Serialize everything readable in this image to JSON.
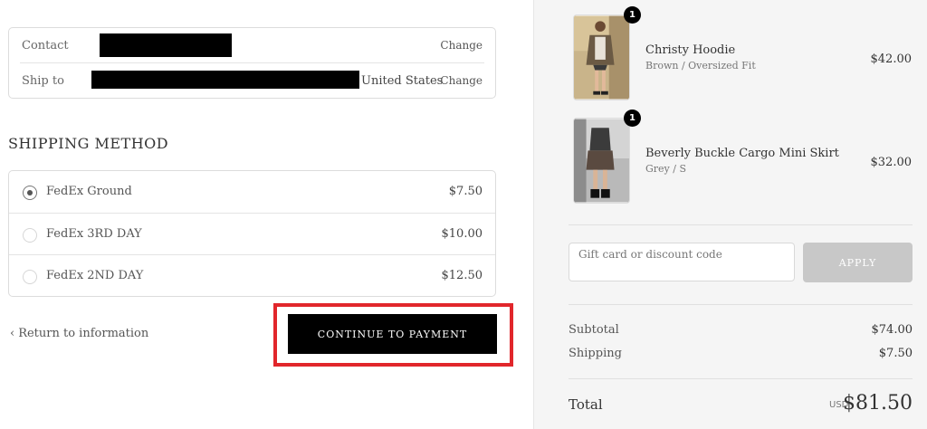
{
  "contact": {
    "label": "Contact",
    "change": "Change"
  },
  "ship_to": {
    "label": "Ship to",
    "country": "United States",
    "change": "Change"
  },
  "shipping": {
    "title": "SHIPPING METHOD",
    "options": [
      {
        "name": "FedEx Ground",
        "price": "$7.50",
        "selected": true
      },
      {
        "name": "FedEx 3RD DAY",
        "price": "$10.00",
        "selected": false
      },
      {
        "name": "FedEx 2ND DAY",
        "price": "$12.50",
        "selected": false
      }
    ]
  },
  "nav": {
    "return_label": "Return to information",
    "continue_label": "CONTINUE TO PAYMENT"
  },
  "cart": {
    "items": [
      {
        "name": "Christy Hoodie",
        "variant": "Brown / Oversized Fit",
        "price": "$42.00",
        "qty": "1"
      },
      {
        "name": "Beverly Buckle Cargo Mini Skirt",
        "variant": "Grey / S",
        "price": "$32.00",
        "qty": "1"
      }
    ],
    "discount_placeholder": "Gift card or discount code",
    "apply_label": "APPLY",
    "subtotal_label": "Subtotal",
    "subtotal": "$74.00",
    "shipping_label": "Shipping",
    "shipping": "$7.50",
    "total_label": "Total",
    "currency": "USD",
    "total": "$81.50"
  },
  "colors": {
    "highlight": "#e1262b",
    "button_bg": "#000000",
    "apply_bg": "#c8c8c8",
    "sidebar_bg": "#f5f5f5"
  }
}
